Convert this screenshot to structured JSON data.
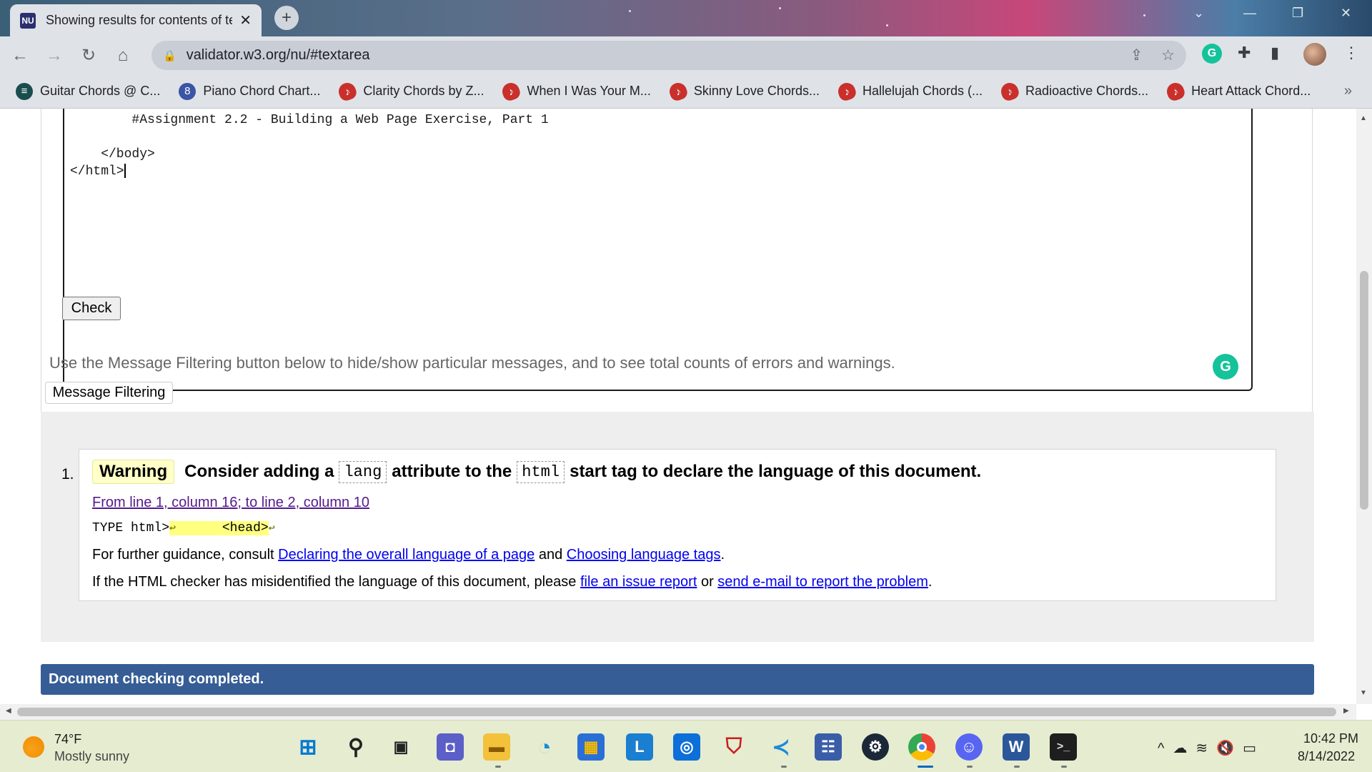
{
  "browser": {
    "tab_title": "Showing results for contents of text-input area",
    "favicon_text": "NU",
    "url": "validator.w3.org/nu/#textarea",
    "new_tab": "+",
    "tab_close": "✕"
  },
  "bookmarks": [
    {
      "label": "Guitar Chords @ C...",
      "icon": "guitar-chords-icon"
    },
    {
      "label": "Piano Chord Chart...",
      "icon": "eight-icon"
    },
    {
      "label": "Clarity Chords by Z...",
      "icon": "guitar-icon"
    },
    {
      "label": "When I Was Your M...",
      "icon": "guitar-icon"
    },
    {
      "label": "Skinny Love Chords...",
      "icon": "guitar-icon"
    },
    {
      "label": "Hallelujah Chords (...",
      "icon": "guitar-icon"
    },
    {
      "label": "Radioactive Chords...",
      "icon": "guitar-icon"
    },
    {
      "label": "Heart Attack Chord...",
      "icon": "guitar-icon"
    }
  ],
  "editor": {
    "line1": "        #Assignment 2.2 - Building a Web Page Exercise, Part 1",
    "line2": "",
    "line3": "    </body>",
    "line4": "</html>"
  },
  "form": {
    "check_label": "Check",
    "filter_hint": "Use the Message Filtering button below to hide/show particular messages, and to see total counts of errors and warnings.",
    "filter_label": "Message Filtering"
  },
  "message": {
    "number": "1.",
    "type": "Warning",
    "text_a": "Consider adding a",
    "code_a": "lang",
    "text_b": "attribute to the",
    "code_b": "html",
    "text_c": "start tag to declare the language of this document.",
    "location": "From line 1, column 16; to line 2, column 10",
    "extract_pre": "TYPE html>",
    "extract_hl_lf": "↩",
    "extract_hl_tag": "      <head>",
    "extract_post_lf": "↩",
    "guidance_pre": "For further guidance, consult ",
    "guidance_link1": "Declaring the overall language of a page",
    "guidance_mid": " and ",
    "guidance_link2": "Choosing language tags",
    "guidance_post": ".",
    "report_pre": "If the HTML checker has misidentified the language of this document, please ",
    "report_link1": "file an issue report",
    "report_mid": " or ",
    "report_link2": "send e-mail to report the problem",
    "report_post": "."
  },
  "status": {
    "done": "Document checking completed."
  },
  "taskbar": {
    "temp": "74°F",
    "weather": "Mostly sunny",
    "time": "10:42 PM",
    "date": "8/14/2022"
  }
}
